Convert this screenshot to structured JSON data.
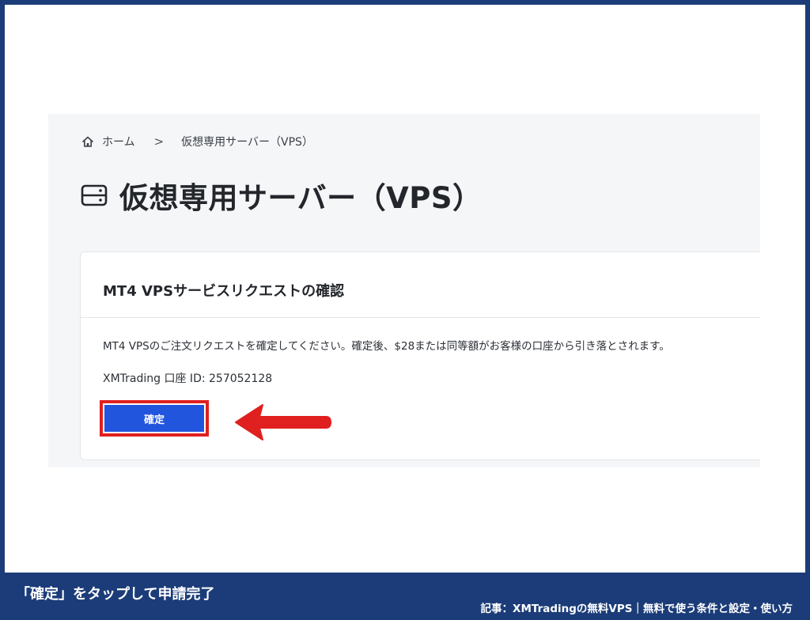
{
  "breadcrumb": {
    "home_label": "ホーム",
    "separator": ">",
    "current": "仮想専用サーバー（VPS）"
  },
  "page": {
    "title": "仮想専用サーバー（VPS）"
  },
  "card": {
    "title": "MT4 VPSサービスリクエストの確認",
    "message": "MT4 VPSのご注文リクエストを確定してください。確定後、$28または同等額がお客様の口座から引き落とされます。",
    "account_line": "XMTrading 口座 ID: 257052128",
    "confirm_label": "確定"
  },
  "caption": {
    "main": "「確定」をタップして申請完了",
    "article": "記事：XMTradingの無料VPS｜無料で使う条件と設定・使い方"
  },
  "colors": {
    "frame_border": "#1b3c78",
    "confirm_button": "#2255de",
    "highlight": "#e0201f"
  },
  "icons": {
    "home": "home-icon",
    "server": "server-icon",
    "arrow": "red-arrow-icon"
  }
}
